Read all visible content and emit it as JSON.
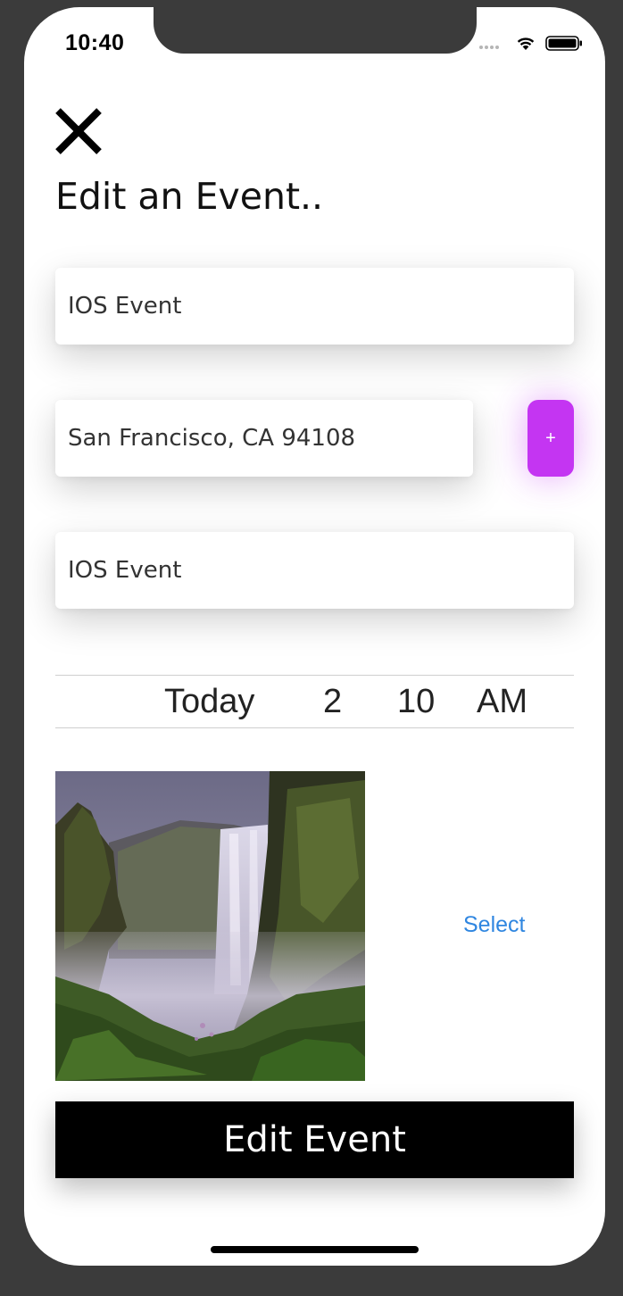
{
  "status_bar": {
    "time": "10:40"
  },
  "header": {
    "title": "Edit an Event.."
  },
  "form": {
    "title_value": "IOS Event",
    "location_value": "San Francisco, CA  94108",
    "add_button_label": "+",
    "description_value": "IOS Event"
  },
  "date_picker": {
    "day": "Today",
    "hour": "2",
    "minute": "10",
    "ampm": "AM"
  },
  "image_picker": {
    "select_label": "Select"
  },
  "submit": {
    "label": "Edit Event"
  },
  "colors": {
    "accent_purple": "#c435f2",
    "link_blue": "#2f86e0",
    "submit_bg": "#000000",
    "frame": "#3b3b3b"
  },
  "icons": {
    "close": "close-icon",
    "wifi": "wifi-icon",
    "battery": "battery-icon"
  }
}
